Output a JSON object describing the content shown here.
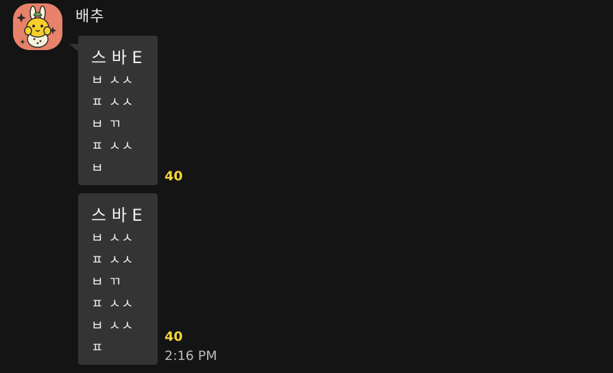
{
  "sender": {
    "name": "배추",
    "avatar_icon": "bunny-character-avatar-icon",
    "avatar_bg": "#e8826a"
  },
  "messages": [
    {
      "lines": [
        "스 바 E",
        "ㅂ ㅅㅅ",
        "ㅍ ㅅㅅ",
        "ㅂ ㄲ",
        "ㅍ ㅅㅅ",
        "ㅂ"
      ],
      "unread_count": "40"
    },
    {
      "lines": [
        "스 바 E",
        "ㅂ ㅅㅅ",
        "ㅍ ㅅㅅ",
        "ㅂ ㄲ",
        "ㅍ ㅅㅅ",
        "ㅂ ㅅㅅ",
        "ㅍ"
      ],
      "unread_count": "40",
      "time": "2:16 PM"
    }
  ],
  "colors": {
    "background": "#141414",
    "bubble": "#343434",
    "unread": "#f2d53c",
    "time": "#bdbdbd"
  }
}
